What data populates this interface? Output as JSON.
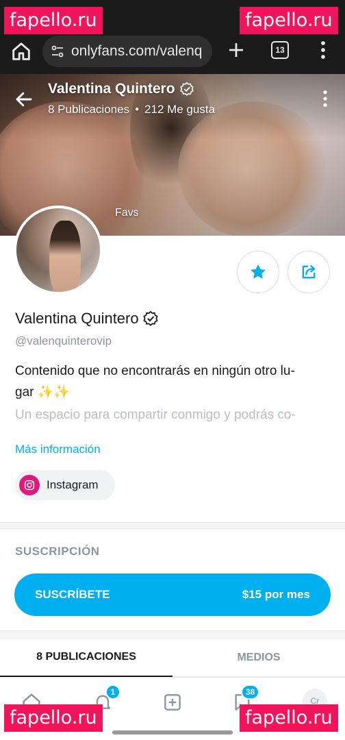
{
  "browser": {
    "url": "onlyfans.com/valenq",
    "tab_count": "13"
  },
  "cover": {
    "name": "Valentina Quintero",
    "posts_stat": "8 Publicaciones",
    "separator": "•",
    "likes_stat": "212 Me gusta",
    "label": "Favs"
  },
  "profile": {
    "name": "Valentina Quintero",
    "handle": "@valenquinterovip",
    "bio_line1": "Contenido que no encontrarás en ningún otro lu-",
    "bio_line2": "gar ✨✨",
    "bio_faded": "Un espacio para compartir conmigo y podrás co-",
    "more_info": "Más información",
    "instagram_label": "Instagram"
  },
  "subscription": {
    "title": "SUSCRIPCIÓN",
    "button_label": "SUSCRÍBETE",
    "price": "$15 por mes"
  },
  "tabs": {
    "posts": "8 PUBLICACIONES",
    "media": "MEDIOS"
  },
  "bottom_nav": {
    "notifications_badge": "1",
    "messages_badge": "38",
    "avatar_initials": "Cr"
  },
  "watermark": "fapello.ru",
  "colors": {
    "accent": "#00aff0",
    "instagram": "#e2197a",
    "watermark": "#f0145a",
    "muted": "#8a96a3"
  },
  "icons": [
    "home-icon",
    "tune-icon",
    "plus-icon",
    "tabs-icon",
    "more-vert-icon",
    "back-arrow-icon",
    "verified-icon",
    "star-icon",
    "share-icon",
    "instagram-icon",
    "bell-icon",
    "add-post-icon",
    "message-icon"
  ]
}
